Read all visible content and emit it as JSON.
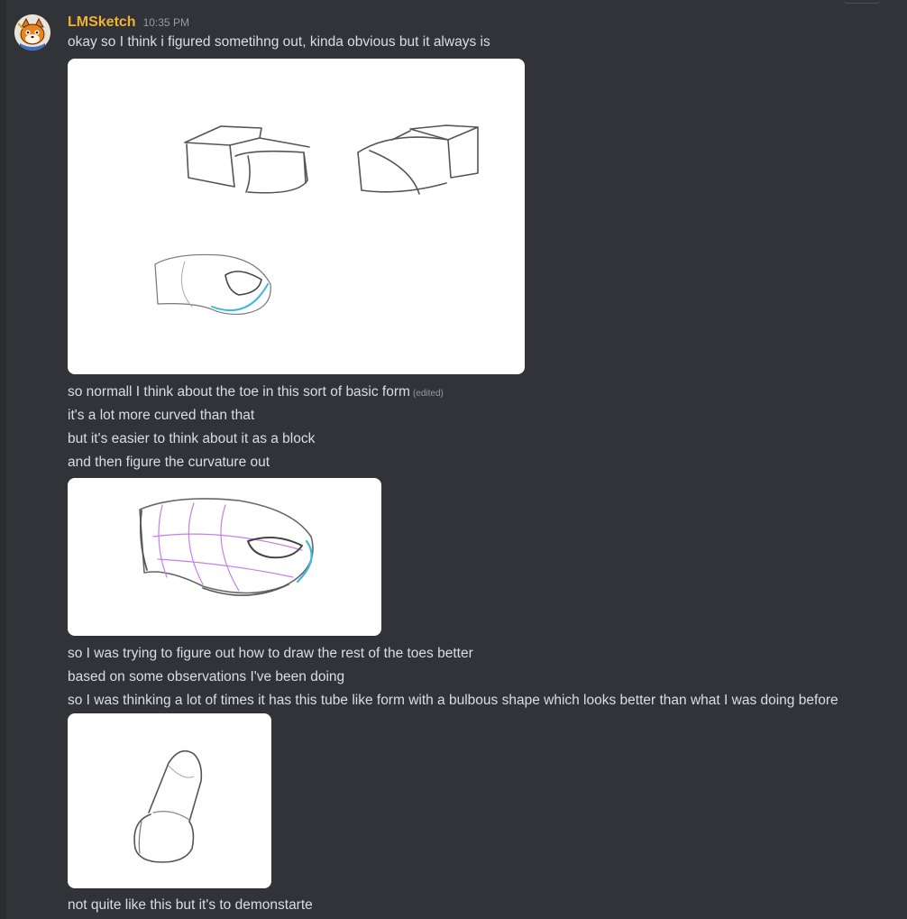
{
  "author": {
    "name": "LMSketch",
    "timestamp": "10:35 PM",
    "name_color": "#f0b232"
  },
  "messages": [
    {
      "text": "okay so I think i figured sometihng out, kinda obvious but it always is"
    },
    {
      "text": "so normall I think about the toe in this sort of basic form",
      "edited_label": "(edited)"
    },
    {
      "text": "it's a lot more curved than that"
    },
    {
      "text": "but it's easier to think about it as a block"
    },
    {
      "text": "and then figure the curvature out"
    },
    {
      "text": "so I was trying to figure out how to draw the rest of the toes better"
    },
    {
      "text": "based on some observations I've been doing"
    },
    {
      "text": "so I was thinking a lot of times it has this tube like form with a bulbous shape which looks better than what I was doing before"
    },
    {
      "text": "not quite like this but it's to demonstarte"
    }
  ],
  "attachments": [
    {
      "kind": "sketch",
      "subject": "block toe forms"
    },
    {
      "kind": "sketch",
      "subject": "curved toe form with purple contour lines"
    },
    {
      "kind": "sketch",
      "subject": "tube like toe form"
    }
  ],
  "colors": {
    "background": "#313338",
    "text": "#dbdee1",
    "muted": "#949ba4",
    "sketch_cyan": "#3fb6e0",
    "sketch_purple": "#c77ee8"
  }
}
